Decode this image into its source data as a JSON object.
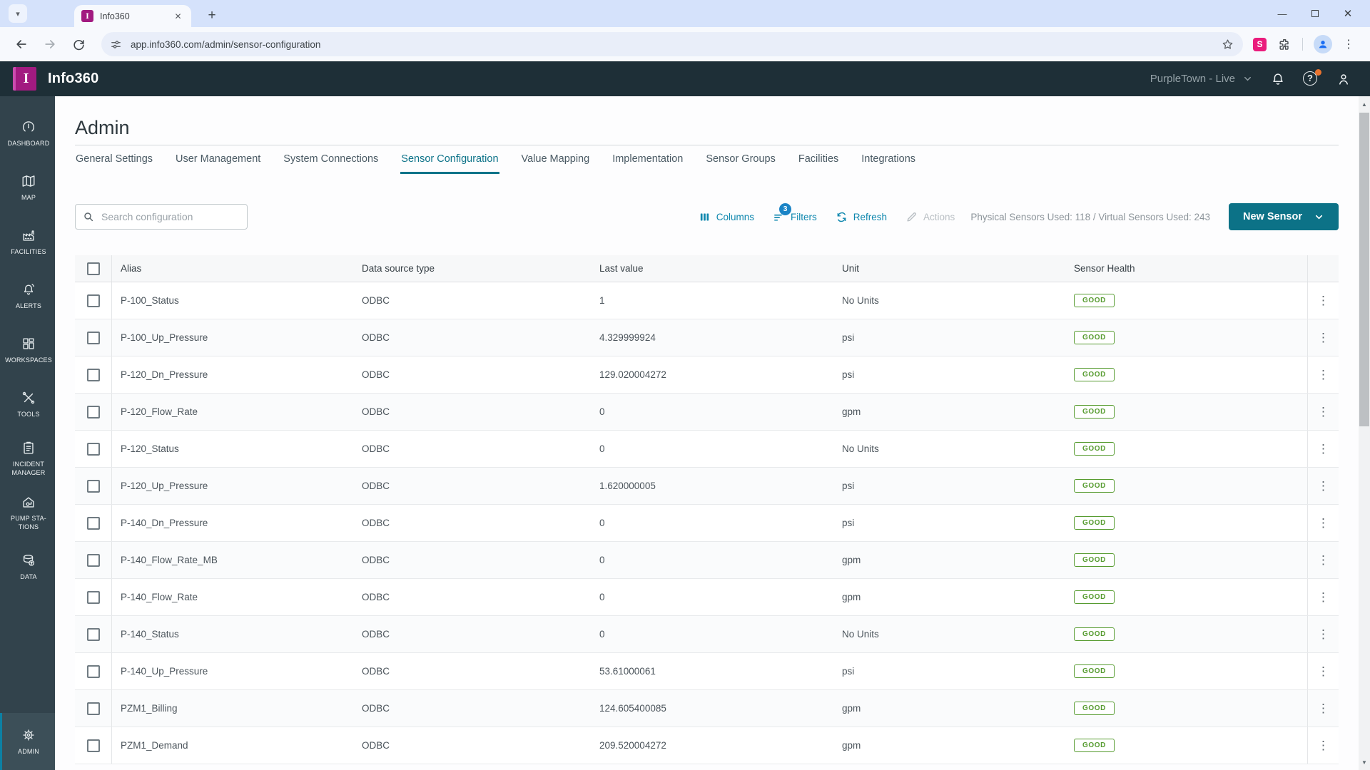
{
  "colors": {
    "brand_magenta": "#a21a80",
    "header_dark": "#1e2f37",
    "sidebar_dark": "#32434c",
    "tab_active": "#0d7389",
    "accent_teal": "#0c7287",
    "link_blue": "#0e87ae",
    "badge_blue": "#1b84c6",
    "health_green": "#569b2f",
    "notify_orange": "#e9732e"
  },
  "browser": {
    "tab_title": "Info360",
    "url": "app.info360.com/admin/sensor-configuration"
  },
  "header": {
    "app_name": "Info360",
    "logo_letter": "I",
    "environment": "PurpleTown - Live"
  },
  "sidebar": {
    "items": [
      {
        "label": "DASHBOARD",
        "icon": "gauge-icon",
        "active": false
      },
      {
        "label": "MAP",
        "icon": "map-icon",
        "active": false
      },
      {
        "label": "FACILITIES",
        "icon": "factory-icon",
        "active": false
      },
      {
        "label": "ALERTS",
        "icon": "bell-wave-icon",
        "active": false
      },
      {
        "label": "WORKSPACES",
        "icon": "grid-icon",
        "active": false
      },
      {
        "label": "TOOLS",
        "icon": "tools-icon",
        "active": false
      },
      {
        "label": "INCIDENT MANAGER",
        "icon": "clipboard-icon",
        "active": false
      },
      {
        "label": "PUMP STA-TIONS",
        "icon": "pump-house-icon",
        "active": false
      },
      {
        "label": "DATA",
        "icon": "database-icon",
        "active": false
      },
      {
        "label": "ADMIN",
        "icon": "gear-icon",
        "active": true
      }
    ]
  },
  "page": {
    "title": "Admin",
    "tabs": [
      "General Settings",
      "User Management",
      "System Connections",
      "Sensor Configuration",
      "Value Mapping",
      "Implementation",
      "Sensor Groups",
      "Facilities",
      "Integrations"
    ],
    "active_tab": "Sensor Configuration"
  },
  "toolbar": {
    "search_placeholder": "Search configuration",
    "columns_label": "Columns",
    "filters_label": "Filters",
    "filters_badge": "3",
    "refresh_label": "Refresh",
    "actions_label": "Actions",
    "usage_text": "Physical Sensors Used: 118 / Virtual Sensors Used: 243",
    "new_sensor_label": "New Sensor"
  },
  "table": {
    "columns": [
      "Alias",
      "Data source type",
      "Last value",
      "Unit",
      "Sensor Health"
    ],
    "rows": [
      {
        "alias": "P-100_Status",
        "data_source_type": "ODBC",
        "last_value": "1",
        "unit": "No Units",
        "health": "GOOD"
      },
      {
        "alias": "P-100_Up_Pressure",
        "data_source_type": "ODBC",
        "last_value": "4.329999924",
        "unit": "psi",
        "health": "GOOD"
      },
      {
        "alias": "P-120_Dn_Pressure",
        "data_source_type": "ODBC",
        "last_value": "129.020004272",
        "unit": "psi",
        "health": "GOOD"
      },
      {
        "alias": "P-120_Flow_Rate",
        "data_source_type": "ODBC",
        "last_value": "0",
        "unit": "gpm",
        "health": "GOOD"
      },
      {
        "alias": "P-120_Status",
        "data_source_type": "ODBC",
        "last_value": "0",
        "unit": "No Units",
        "health": "GOOD"
      },
      {
        "alias": "P-120_Up_Pressure",
        "data_source_type": "ODBC",
        "last_value": "1.620000005",
        "unit": "psi",
        "health": "GOOD"
      },
      {
        "alias": "P-140_Dn_Pressure",
        "data_source_type": "ODBC",
        "last_value": "0",
        "unit": "psi",
        "health": "GOOD"
      },
      {
        "alias": "P-140_Flow_Rate_MB",
        "data_source_type": "ODBC",
        "last_value": "0",
        "unit": "gpm",
        "health": "GOOD"
      },
      {
        "alias": "P-140_Flow_Rate",
        "data_source_type": "ODBC",
        "last_value": "0",
        "unit": "gpm",
        "health": "GOOD"
      },
      {
        "alias": "P-140_Status",
        "data_source_type": "ODBC",
        "last_value": "0",
        "unit": "No Units",
        "health": "GOOD"
      },
      {
        "alias": "P-140_Up_Pressure",
        "data_source_type": "ODBC",
        "last_value": "53.61000061",
        "unit": "psi",
        "health": "GOOD"
      },
      {
        "alias": "PZM1_Billing",
        "data_source_type": "ODBC",
        "last_value": "124.605400085",
        "unit": "gpm",
        "health": "GOOD"
      },
      {
        "alias": "PZM1_Demand",
        "data_source_type": "ODBC",
        "last_value": "209.520004272",
        "unit": "gpm",
        "health": "GOOD"
      }
    ]
  }
}
